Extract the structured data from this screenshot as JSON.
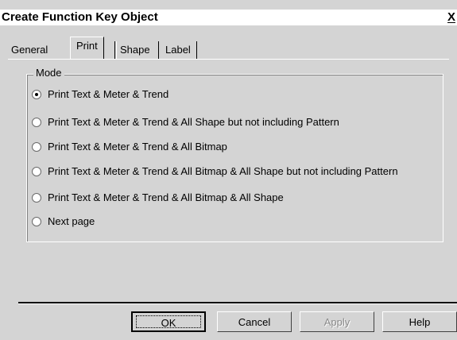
{
  "window": {
    "title": "Create Function Key Object",
    "close_label": "X"
  },
  "tabs": [
    {
      "label": "General"
    },
    {
      "label": "Print"
    },
    {
      "label": "Shape"
    },
    {
      "label": "Label"
    }
  ],
  "mode": {
    "label": "Mode",
    "options": [
      {
        "label": "Print Text & Meter & Trend",
        "checked": true
      },
      {
        "label": "Print Text & Meter & Trend & All Shape but not including Pattern",
        "checked": false
      },
      {
        "label": "Print Text & Meter & Trend & All Bitmap",
        "checked": false
      },
      {
        "label": "Print Text & Meter & Trend & All Bitmap &  All Shape but not including Pattern",
        "checked": false
      },
      {
        "label": "Print Text & Meter & Trend & All Bitmap &  All Shape",
        "checked": false
      },
      {
        "label": "Next page",
        "checked": false
      }
    ]
  },
  "buttons": {
    "ok": "OK",
    "cancel": "Cancel",
    "apply": "Apply",
    "help": "Help"
  }
}
